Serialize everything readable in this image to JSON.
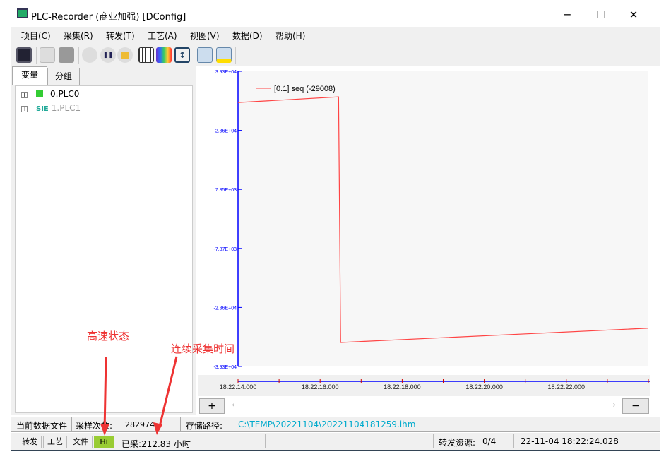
{
  "window": {
    "title": "PLC-Recorder (商业加强) [DConfig]",
    "minimize": "─",
    "maximize": "☐",
    "close": "✕"
  },
  "menu": [
    "项目(C)",
    "采集(R)",
    "转发(T)",
    "工艺(A)",
    "视图(V)",
    "数据(D)",
    "帮助(H)"
  ],
  "toolbar": [
    "plc-rack-icon",
    "open-folder-icon",
    "save-icon",
    "record-icon",
    "pause-icon",
    "stop-icon",
    "grid-icon",
    "color-palette-icon",
    "fit-vertical-icon",
    "save-chart-icon",
    "open-chart-icon"
  ],
  "left_tabs": [
    "变量",
    "分组"
  ],
  "tree": [
    {
      "label": "0.PLC0",
      "status_color": "#33cc33"
    },
    {
      "label": "1.PLC1",
      "status_color": "#aaaaaa",
      "badge": "SIE"
    }
  ],
  "chart_buttons": {
    "zoom_in": "+",
    "zoom_out": "−",
    "scroll_left": "‹",
    "scroll_right": "›"
  },
  "chart_data": {
    "type": "line",
    "y_ticks": [
      "3.93E+04",
      "2.36E+04",
      "7.85E+03",
      "-7.87E+03",
      "-2.36E+04",
      "-3.93E+04"
    ],
    "ylim": [
      -39300,
      39300
    ],
    "x_ticks": [
      "18:22:14.000",
      "18:22:16.000",
      "18:22:18.000",
      "18:22:20.000",
      "18:22:22.000"
    ],
    "xlim": [
      "18:22:14.000",
      "18:22:24.000"
    ],
    "legend_position": "top-left",
    "series": [
      {
        "name": "[0.1] seq (-29008)",
        "color": "#ff4444",
        "points": [
          [
            "18:22:14.000",
            31000
          ],
          [
            "18:22:16.450",
            32500
          ],
          [
            "18:22:16.500",
            -32900
          ],
          [
            "18:22:24.000",
            -29100
          ]
        ]
      }
    ]
  },
  "status1": {
    "file_label": "当前数据文件",
    "count_label": "采样次数:",
    "count": "282974",
    "path_label": "存储路径:",
    "path": "C:\\TEMP\\20221104\\20221104181259.ihm"
  },
  "status2": {
    "forward": "转发",
    "process": "工艺",
    "file": "文件",
    "hi": "Hi",
    "elapsed": "已采:212.83 小时",
    "resource_label": "转发资源:",
    "resource": "0/4",
    "datetime": "22-11-04 18:22:24.028"
  },
  "annotations": {
    "high_speed": "高速状态",
    "continuous": "连续采集时间"
  },
  "colors": {
    "accent_line": "#ff4444",
    "axis": "#0000ff",
    "hi_badge": "#99cc33",
    "path": "#00aacc",
    "annotation": "#e33333"
  }
}
